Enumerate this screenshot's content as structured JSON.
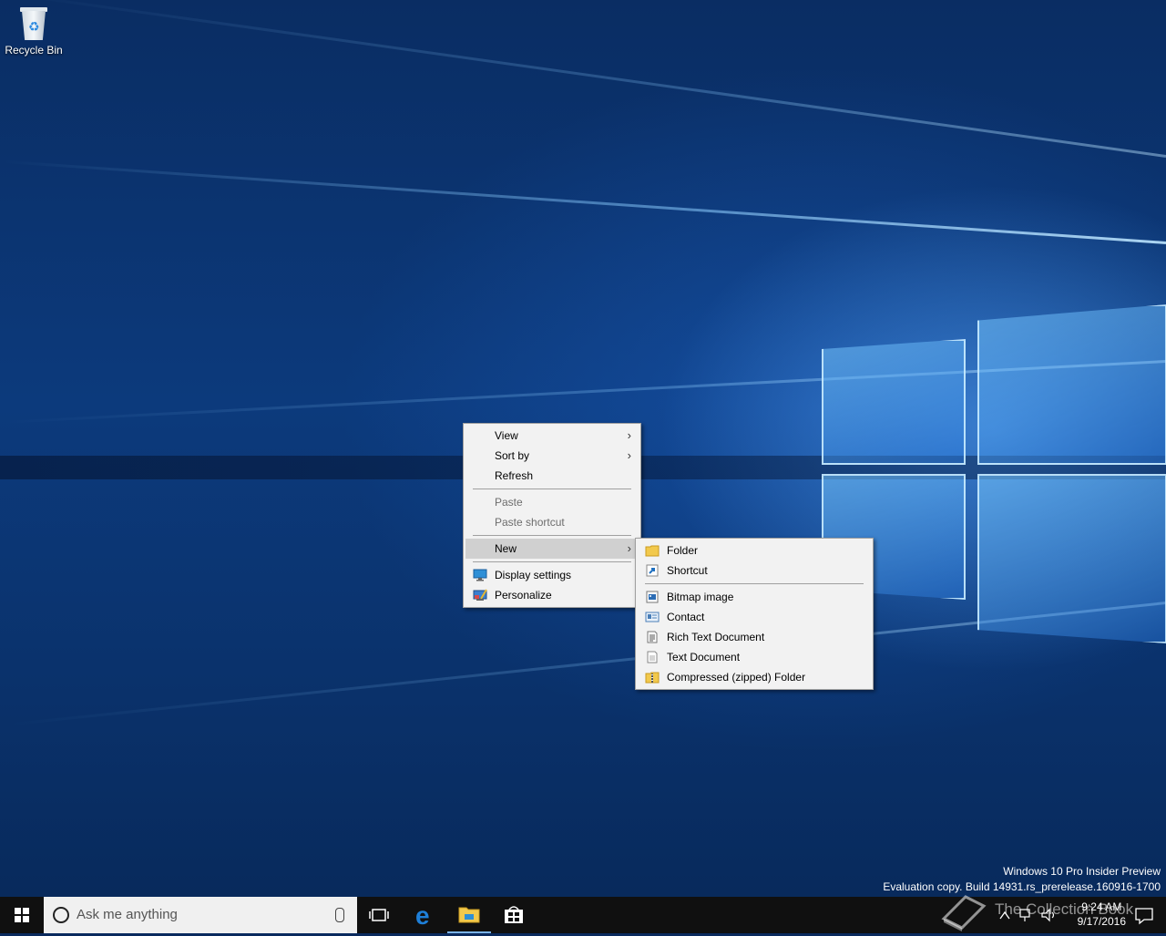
{
  "desktop": {
    "icons": [
      {
        "label": "Recycle Bin",
        "icon": "recycle-bin-icon"
      }
    ]
  },
  "context_menu": {
    "items": [
      {
        "label": "View",
        "submenu": true,
        "disabled": false
      },
      {
        "label": "Sort by",
        "submenu": true,
        "disabled": false
      },
      {
        "label": "Refresh",
        "submenu": false,
        "disabled": false
      },
      {
        "label": "Paste",
        "submenu": false,
        "disabled": true
      },
      {
        "label": "Paste shortcut",
        "submenu": false,
        "disabled": true
      },
      {
        "label": "New",
        "submenu": true,
        "disabled": false,
        "highlighted": true
      },
      {
        "label": "Display settings",
        "icon": "display-settings-icon"
      },
      {
        "label": "Personalize",
        "icon": "personalize-icon"
      }
    ]
  },
  "new_submenu": {
    "items": [
      {
        "label": "Folder",
        "icon": "folder-icon"
      },
      {
        "label": "Shortcut",
        "icon": "shortcut-icon"
      },
      {
        "label": "Bitmap image",
        "icon": "bitmap-icon"
      },
      {
        "label": "Contact",
        "icon": "contact-icon"
      },
      {
        "label": "Rich Text Document",
        "icon": "rich-text-icon"
      },
      {
        "label": "Text Document",
        "icon": "text-document-icon"
      },
      {
        "label": "Compressed (zipped) Folder",
        "icon": "zip-folder-icon"
      }
    ]
  },
  "watermark": {
    "line1": "Windows 10 Pro Insider Preview",
    "line2": "Evaluation copy. Build 14931.rs_prerelease.160916-1700"
  },
  "overlay_text": "The Collection Book",
  "taskbar": {
    "search_placeholder": "Ask me anything",
    "time": "9:24 AM",
    "date": "9/17/2016"
  },
  "colors": {
    "menu_bg": "#f2f2f2",
    "menu_highlight": "#d0d0d0",
    "taskbar_bg": "#101010",
    "edge_blue": "#1e7fd8",
    "folder_yellow": "#f2c94c"
  }
}
